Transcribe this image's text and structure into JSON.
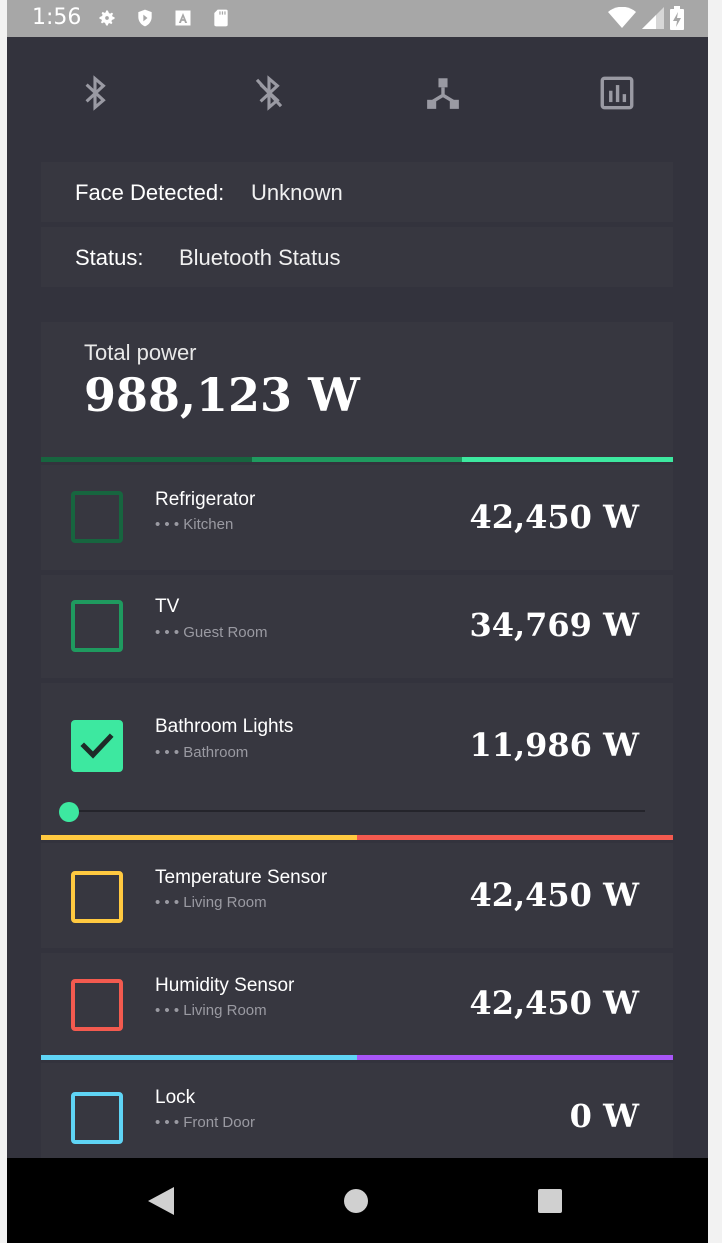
{
  "status_bar": {
    "time": "1:56",
    "icons": [
      "gear-icon",
      "shield-play-icon",
      "a-font-icon",
      "sd-card-icon",
      "wifi-icon",
      "signal-icon",
      "battery-charging-icon"
    ]
  },
  "toolbar": {
    "buttons": [
      "bluetooth-icon",
      "bluetooth-disabled-icon",
      "hub-icon",
      "bar-chart-icon"
    ]
  },
  "face_detected": {
    "label": "Face Detected:",
    "value": "Unknown"
  },
  "status": {
    "label": "Status:",
    "value": "Bluetooth Status"
  },
  "total_power": {
    "label": "Total power",
    "value": "988,123 W"
  },
  "devices": [
    {
      "name": "Refrigerator",
      "room": "• • • Kitchen",
      "watts": "42,450 W",
      "color": "#17653f",
      "checked": false
    },
    {
      "name": "TV",
      "room": "• • • Guest Room",
      "watts": "34,769 W",
      "color": "#1f9a5f",
      "checked": false
    },
    {
      "name": "Bathroom Lights",
      "room": "• • • Bathroom",
      "watts": "11,986 W",
      "color": "#3de8a0",
      "checked": true,
      "slider": 0
    },
    {
      "name": "Temperature Sensor",
      "room": "• • • Living Room",
      "watts": "42,450 W",
      "color": "#ffc940",
      "checked": false
    },
    {
      "name": "Humidity Sensor",
      "room": "• • • Living Room",
      "watts": "42,450 W",
      "color": "#f35a4f",
      "checked": false
    },
    {
      "name": "Lock",
      "room": "• • • Front Door",
      "watts": "0 W",
      "color": "#5fd4f5",
      "checked": false
    }
  ],
  "colors": {
    "background": "#33333d",
    "card": "#373740",
    "green_dark": "#17653f",
    "green_mid": "#1f9a5f",
    "green_light": "#3de8a0",
    "yellow": "#ffc940",
    "red": "#f35a4f",
    "cyan": "#5fd4f5",
    "purple": "#a855f7"
  },
  "nav_bar": [
    "back-icon",
    "home-icon",
    "recents-icon"
  ]
}
